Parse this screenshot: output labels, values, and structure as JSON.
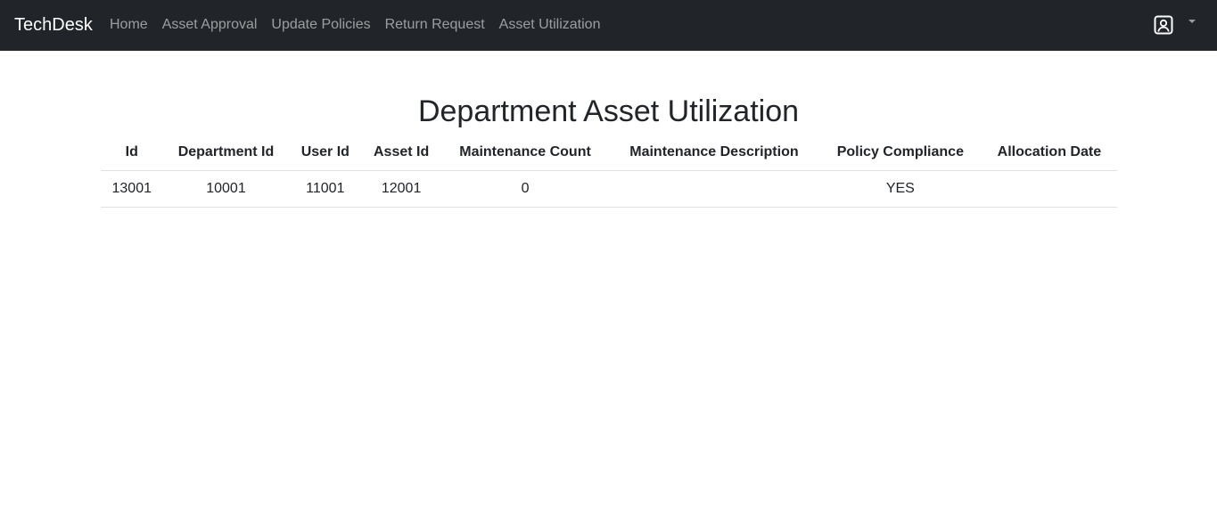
{
  "navbar": {
    "brand": "TechDesk",
    "links": [
      {
        "label": "Home"
      },
      {
        "label": "Asset Approval"
      },
      {
        "label": "Update Policies"
      },
      {
        "label": "Return Request"
      },
      {
        "label": "Asset Utilization"
      }
    ],
    "user_icon": "user-badge-icon",
    "dropdown_icon": "caret-down-icon"
  },
  "page": {
    "title": "Department Asset Utilization"
  },
  "table": {
    "columns": [
      "Id",
      "Department Id",
      "User Id",
      "Asset Id",
      "Maintenance Count",
      "Maintenance Description",
      "Policy Compliance",
      "Allocation Date"
    ],
    "rows": [
      [
        "13001",
        "10001",
        "11001",
        "12001",
        "0",
        "",
        "YES",
        ""
      ]
    ]
  },
  "colors": {
    "navbar_bg": "#212529",
    "nav_link": "rgba(255,255,255,0.55)",
    "brand": "#ffffff",
    "text": "#212529",
    "border": "#dee2e6"
  }
}
